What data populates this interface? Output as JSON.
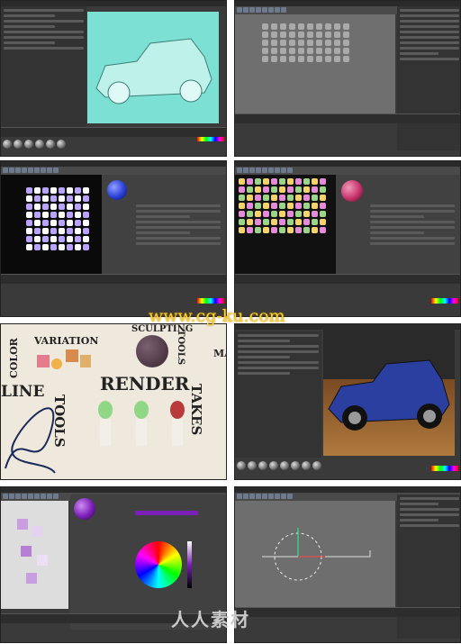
{
  "watermarks": {
    "top": "www.cg-ku.com",
    "bottom": "人人素材"
  },
  "promo_panel": {
    "color_variation_line1": "COLOR",
    "color_variation_line2": "VARIATION",
    "sculpting_tools_line1": "SCULPTING",
    "sculpting_tools_line2": "TOOLS",
    "line_tools_line1": "LINE",
    "line_tools_line2": "TOOLS",
    "render": "RENDER",
    "takes": "TAKES",
    "partial_label": "MA"
  },
  "colors": {
    "ui_dark": "#3a3a3a",
    "viewport_car": "#7de0d4",
    "car_blue": "#2a3fa0",
    "sphere_blue": "#2b3fd6",
    "sphere_pink": "#c8326c",
    "sphere_purple": "#7a1fb8",
    "watermark_yellow": "#f2d72a"
  },
  "icons": [
    "sphere-material-icon",
    "color-wheel-icon",
    "car-model-icon"
  ]
}
